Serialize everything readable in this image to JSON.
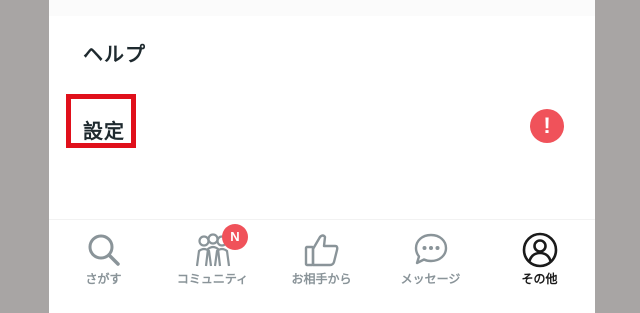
{
  "menu": {
    "help_label": "ヘルプ",
    "settings_label": "設定",
    "settings_alert": "!"
  },
  "tabbar": {
    "tabs": [
      {
        "label": "さがす",
        "icon": "search-icon"
      },
      {
        "label": "コミュニティ",
        "icon": "community-icon",
        "badge": "N"
      },
      {
        "label": "お相手から",
        "icon": "thumbs-up-icon"
      },
      {
        "label": "メッセージ",
        "icon": "message-bubble-icon"
      },
      {
        "label": "その他",
        "icon": "user-circle-icon",
        "active": true
      }
    ]
  },
  "colors": {
    "highlight": "#e0101b",
    "badge": "#f0525a",
    "inactive_tab": "#8a9499",
    "active_tab": "#1a1a1a"
  }
}
